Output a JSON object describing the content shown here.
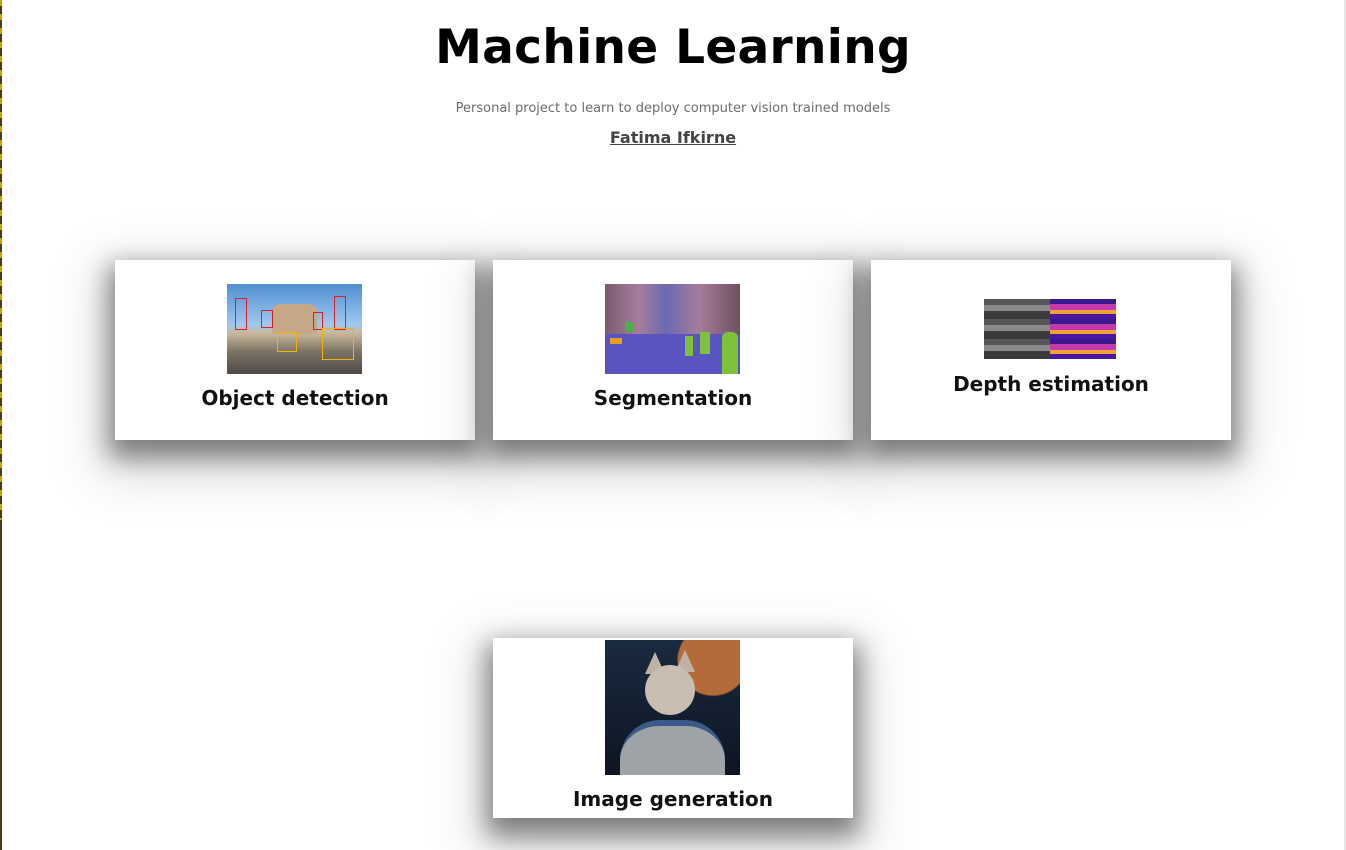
{
  "header": {
    "title": "Machine Learning",
    "subtitle": "Personal project to learn to deploy computer vision trained models",
    "author": "Fatima Ifkirne"
  },
  "cards": [
    {
      "label": "Object detection",
      "icon": "object-detection-thumbnail"
    },
    {
      "label": "Segmentation",
      "icon": "segmentation-thumbnail"
    },
    {
      "label": "Depth estimation",
      "icon": "depth-estimation-thumbnail"
    },
    {
      "label": "Image generation",
      "icon": "image-generation-thumbnail"
    }
  ]
}
